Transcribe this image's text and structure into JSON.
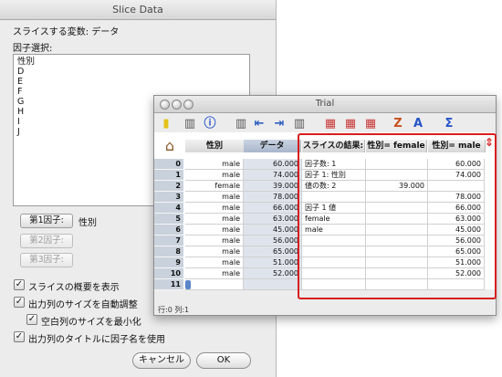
{
  "dialog": {
    "title": "Slice Data",
    "slice_var_line": "スライスする変数: データ",
    "factor_select_label": "因子選択:",
    "factors": [
      "性別",
      "D",
      "E",
      "F",
      "G",
      "H",
      "I",
      "J"
    ],
    "factor1_button": "第1因子:",
    "factor1_value": "性別",
    "factor2_button": "第2因子:",
    "factor3_button": "第3因子:",
    "options": [
      {
        "label": "スライスの概要を表示",
        "checked": true
      },
      {
        "label": "出力列のサイズを自動調整",
        "checked": true
      },
      {
        "label": "空白列のサイズを最小化",
        "checked": true
      },
      {
        "label": "出力列のタイトルに因子名を使用",
        "checked": true
      }
    ],
    "cancel_label": "キャンセル",
    "ok_label": "OK"
  },
  "trial": {
    "title": "Trial",
    "status": "行:0  列:1",
    "headers": [
      "性別",
      "データ",
      "スライスの結果:",
      "性別= female",
      "性別= male"
    ],
    "rows": [
      {
        "n": "0",
        "sex": "male",
        "data": "60.000",
        "summary": "因子数: 1",
        "female": "",
        "male": "60.000"
      },
      {
        "n": "1",
        "sex": "male",
        "data": "74.000",
        "summary": "因子 1: 性別",
        "female": "",
        "male": "74.000"
      },
      {
        "n": "2",
        "sex": "female",
        "data": "39.000",
        "summary": "値の数: 2",
        "female": "39.000",
        "male": ""
      },
      {
        "n": "3",
        "sex": "male",
        "data": "78.000",
        "summary": "",
        "female": "",
        "male": "78.000"
      },
      {
        "n": "4",
        "sex": "male",
        "data": "66.000",
        "summary": "因子 1 値",
        "female": "",
        "male": "66.000"
      },
      {
        "n": "5",
        "sex": "male",
        "data": "63.000",
        "summary": "female",
        "female": "",
        "male": "63.000"
      },
      {
        "n": "6",
        "sex": "male",
        "data": "45.000",
        "summary": "male",
        "female": "",
        "male": "45.000"
      },
      {
        "n": "7",
        "sex": "male",
        "data": "56.000",
        "summary": "",
        "female": "",
        "male": "56.000"
      },
      {
        "n": "8",
        "sex": "male",
        "data": "65.000",
        "summary": "",
        "female": "",
        "male": "65.000"
      },
      {
        "n": "9",
        "sex": "male",
        "data": "51.000",
        "summary": "",
        "female": "",
        "male": "51.000"
      },
      {
        "n": "10",
        "sex": "male",
        "data": "52.000",
        "summary": "",
        "female": "",
        "male": "52.000"
      },
      {
        "n": "11",
        "sex": "",
        "data": "",
        "summary": "",
        "female": "",
        "male": ""
      }
    ],
    "highlight_color": "#d81e1e",
    "toolbar_icons": [
      "new-doc-icon",
      "column-icon",
      "info-icon",
      "table-icon",
      "insert-left-icon",
      "insert-right-icon",
      "slice-icon",
      "slice-2-icon",
      "slice-3-icon",
      "sort-za-icon",
      "sort-az-icon",
      "sigma-icon"
    ]
  }
}
